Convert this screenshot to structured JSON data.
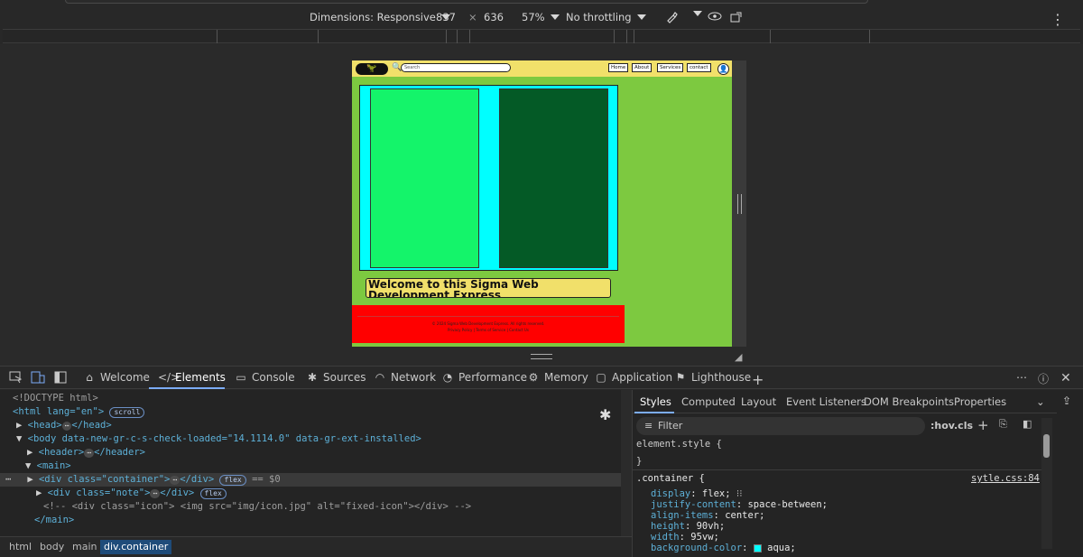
{
  "device_toolbar": {
    "dimensions_label": "Dimensions: Responsive",
    "width": "837",
    "times": "×",
    "height": "636",
    "zoom": "57%",
    "throttling": "No throttling"
  },
  "site": {
    "logo_text": "🦖",
    "search_placeholder": "Search",
    "nav": [
      "Home",
      "About",
      "Services",
      "contact"
    ],
    "note_text": "Welcome to this Sigma Web Development Express",
    "footer_copy": "© 2024 Sigma Web Development Express. All rights reserved.",
    "footer_links": [
      "Privacy Policy",
      "Terms of Service",
      "Contact Us"
    ],
    "colors": {
      "header": "#f1e06a",
      "page_bg": "#7dc940",
      "container": "#00ffff",
      "box1": "#14f46a",
      "box2": "#045a26",
      "footer": "#ff0000"
    }
  },
  "devtools": {
    "tabs": [
      "Welcome",
      "Elements",
      "Console",
      "Sources",
      "Network",
      "Performance",
      "Memory",
      "Application",
      "Lighthouse"
    ],
    "active_tab": "Elements",
    "elements": {
      "doctype": "<!DOCTYPE html>",
      "html_open": "<html lang=\"en\">",
      "scroll_badge": "scroll",
      "head": "<head>",
      "head_close": "</head>",
      "body_open": "<body data-new-gr-c-s-check-loaded=\"14.1114.0\" data-gr-ext-installed>",
      "header": "<header>",
      "header_close": "</header>",
      "main_open": "<main>",
      "container_line": "<div class=\"container\">",
      "div_close": "</div>",
      "flex_badge": "flex",
      "eq_dollar": "== $0",
      "note_line": "<div class=\"note\">",
      "comment_line": "<!-- <div class=\"icon\"> <img src=\"img/icon.jpg\" alt=\"fixed-icon\"></div> -->",
      "main_close": "</main>"
    },
    "breadcrumbs": [
      "html",
      "body",
      "main",
      "div.container"
    ],
    "styles": {
      "tabs": [
        "Styles",
        "Computed",
        "Layout",
        "Event Listeners",
        "DOM Breakpoints",
        "Properties"
      ],
      "filter_placeholder": "Filter",
      "hov": ":hov",
      "cls": ".cls",
      "element_style": "element.style {",
      "close_brace": "}",
      "selector": ".container {",
      "source": "sytle.css:84",
      "props": [
        {
          "name": "display",
          "value": "flex;"
        },
        {
          "name": "justify-content",
          "value": "space-between;"
        },
        {
          "name": "align-items",
          "value": "center;"
        },
        {
          "name": "height",
          "value": "90vh;"
        },
        {
          "name": "width",
          "value": "95vw;"
        },
        {
          "name": "background-color",
          "value": "aqua;"
        }
      ]
    }
  }
}
